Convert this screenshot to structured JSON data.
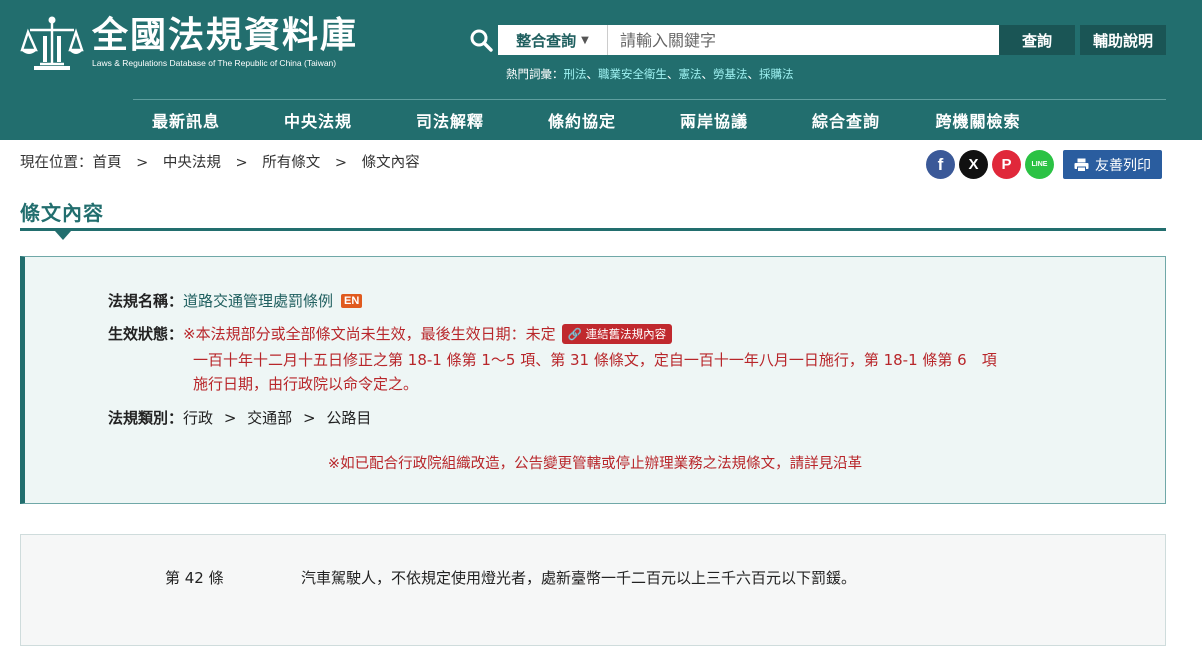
{
  "site": {
    "title": "全國法規資料庫",
    "subtitle": "Laws & Regulations Database of The Republic of China (Taiwan)"
  },
  "search": {
    "scope": "整合查詢",
    "placeholder": "請輸入關鍵字",
    "submit": "查詢",
    "help": "輔助說明"
  },
  "hot": {
    "label": "熱門詞彙：",
    "terms": [
      "刑法",
      "職業安全衛生",
      "憲法",
      "勞基法",
      "採購法"
    ]
  },
  "nav": [
    "最新訊息",
    "中央法規",
    "司法解釋",
    "條約協定",
    "兩岸協議",
    "綜合查詢",
    "跨機關檢索"
  ],
  "breadcrumb": {
    "prefix": "現在位置：",
    "items": [
      "首頁",
      "中央法規",
      "所有條文",
      "條文內容"
    ],
    "sep": ">"
  },
  "share": {
    "facebook": "f",
    "x": "X",
    "plurk": "P",
    "line": "LINE",
    "print": "友善列印"
  },
  "page_title": "條文內容",
  "law": {
    "name_label": "法規名稱：",
    "name": "道路交通管理處罰條例",
    "en_badge": "EN",
    "status_label": "生效狀態：",
    "status_line1": "※本法規部分或全部條文尚未生效，最後生效日期：未定",
    "old_link": "連結舊法規內容",
    "status_line2": "一百十年十二月十五日修正之第 18-1 條第 1～5 項、第 31 條條文，定自一百十一年八月一日施行，第 18-1 條第 6　項",
    "status_line3": "施行日期，由行政院以命令定之。",
    "category_label": "法規類別：",
    "category": [
      "行政",
      "交通部",
      "公路目"
    ],
    "category_sep": ">",
    "notice": "※如已配合行政院組織改造，公告變更管轄或停止辦理業務之法規條文，請詳見沿革"
  },
  "article": {
    "number": "第 42 條",
    "text": "汽車駕駛人，不依規定使用燈光者，處新臺幣一千二百元以上三千六百元以下罰鍰。"
  },
  "colors": {
    "header": "#226e6e",
    "accent": "#b8262a",
    "print": "#2a5d9f"
  }
}
